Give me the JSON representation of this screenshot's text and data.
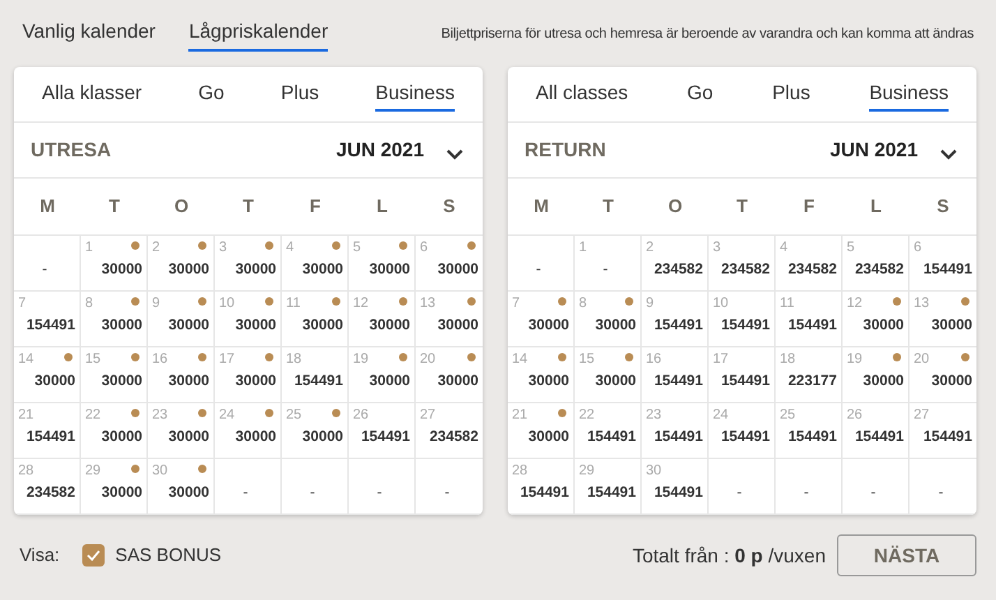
{
  "calendar_tabs": [
    {
      "label": "Vanlig kalender",
      "selected": false
    },
    {
      "label": "Lågpriskalender",
      "selected": true
    }
  ],
  "notice": "Biljettpriserna för utresa och hemresa är beroende av varandra och kan komma att ändras",
  "calendars": [
    {
      "class_tabs": [
        {
          "label": "Alla klasser",
          "selected": false
        },
        {
          "label": "Go",
          "selected": false
        },
        {
          "label": "Plus",
          "selected": false
        },
        {
          "label": "Business",
          "selected": true
        }
      ],
      "title": "UTRESA",
      "month": "JUN 2021",
      "weekdays": [
        "M",
        "T",
        "O",
        "T",
        "F",
        "L",
        "S"
      ],
      "cells": [
        {
          "price": "-",
          "marked": false
        },
        {
          "day": "1",
          "price": "30000",
          "marked": true
        },
        {
          "day": "2",
          "price": "30000",
          "marked": true
        },
        {
          "day": "3",
          "price": "30000",
          "marked": true
        },
        {
          "day": "4",
          "price": "30000",
          "marked": true
        },
        {
          "day": "5",
          "price": "30000",
          "marked": true
        },
        {
          "day": "6",
          "price": "30000",
          "marked": true
        },
        {
          "day": "7",
          "price": "154491",
          "marked": false
        },
        {
          "day": "8",
          "price": "30000",
          "marked": true
        },
        {
          "day": "9",
          "price": "30000",
          "marked": true
        },
        {
          "day": "10",
          "price": "30000",
          "marked": true
        },
        {
          "day": "11",
          "price": "30000",
          "marked": true
        },
        {
          "day": "12",
          "price": "30000",
          "marked": true
        },
        {
          "day": "13",
          "price": "30000",
          "marked": true
        },
        {
          "day": "14",
          "price": "30000",
          "marked": true
        },
        {
          "day": "15",
          "price": "30000",
          "marked": true
        },
        {
          "day": "16",
          "price": "30000",
          "marked": true
        },
        {
          "day": "17",
          "price": "30000",
          "marked": true
        },
        {
          "day": "18",
          "price": "154491",
          "marked": false
        },
        {
          "day": "19",
          "price": "30000",
          "marked": true
        },
        {
          "day": "20",
          "price": "30000",
          "marked": true
        },
        {
          "day": "21",
          "price": "154491",
          "marked": false
        },
        {
          "day": "22",
          "price": "30000",
          "marked": true
        },
        {
          "day": "23",
          "price": "30000",
          "marked": true
        },
        {
          "day": "24",
          "price": "30000",
          "marked": true
        },
        {
          "day": "25",
          "price": "30000",
          "marked": true
        },
        {
          "day": "26",
          "price": "154491",
          "marked": false
        },
        {
          "day": "27",
          "price": "234582",
          "marked": false
        },
        {
          "day": "28",
          "price": "234582",
          "marked": false
        },
        {
          "day": "29",
          "price": "30000",
          "marked": true
        },
        {
          "day": "30",
          "price": "30000",
          "marked": true
        },
        {
          "price": "-",
          "marked": false
        },
        {
          "price": "-",
          "marked": false
        },
        {
          "price": "-",
          "marked": false
        },
        {
          "price": "-",
          "marked": false
        }
      ]
    },
    {
      "class_tabs": [
        {
          "label": "All classes",
          "selected": false
        },
        {
          "label": "Go",
          "selected": false
        },
        {
          "label": "Plus",
          "selected": false
        },
        {
          "label": "Business",
          "selected": true
        }
      ],
      "title": "RETURN",
      "month": "JUN 2021",
      "weekdays": [
        "M",
        "T",
        "O",
        "T",
        "F",
        "L",
        "S"
      ],
      "cells": [
        {
          "price": "-",
          "marked": false
        },
        {
          "day": "1",
          "price": "-",
          "marked": false
        },
        {
          "day": "2",
          "price": "234582",
          "marked": false
        },
        {
          "day": "3",
          "price": "234582",
          "marked": false
        },
        {
          "day": "4",
          "price": "234582",
          "marked": false
        },
        {
          "day": "5",
          "price": "234582",
          "marked": false
        },
        {
          "day": "6",
          "price": "154491",
          "marked": false
        },
        {
          "day": "7",
          "price": "30000",
          "marked": true
        },
        {
          "day": "8",
          "price": "30000",
          "marked": true
        },
        {
          "day": "9",
          "price": "154491",
          "marked": false
        },
        {
          "day": "10",
          "price": "154491",
          "marked": false
        },
        {
          "day": "11",
          "price": "154491",
          "marked": false
        },
        {
          "day": "12",
          "price": "30000",
          "marked": true
        },
        {
          "day": "13",
          "price": "30000",
          "marked": true
        },
        {
          "day": "14",
          "price": "30000",
          "marked": true
        },
        {
          "day": "15",
          "price": "30000",
          "marked": true
        },
        {
          "day": "16",
          "price": "154491",
          "marked": false
        },
        {
          "day": "17",
          "price": "154491",
          "marked": false
        },
        {
          "day": "18",
          "price": "223177",
          "marked": false
        },
        {
          "day": "19",
          "price": "30000",
          "marked": true
        },
        {
          "day": "20",
          "price": "30000",
          "marked": true
        },
        {
          "day": "21",
          "price": "30000",
          "marked": true
        },
        {
          "day": "22",
          "price": "154491",
          "marked": false
        },
        {
          "day": "23",
          "price": "154491",
          "marked": false
        },
        {
          "day": "24",
          "price": "154491",
          "marked": false
        },
        {
          "day": "25",
          "price": "154491",
          "marked": false
        },
        {
          "day": "26",
          "price": "154491",
          "marked": false
        },
        {
          "day": "27",
          "price": "154491",
          "marked": false
        },
        {
          "day": "28",
          "price": "154491",
          "marked": false
        },
        {
          "day": "29",
          "price": "154491",
          "marked": false
        },
        {
          "day": "30",
          "price": "154491",
          "marked": false
        },
        {
          "price": "-",
          "marked": false
        },
        {
          "price": "-",
          "marked": false
        },
        {
          "price": "-",
          "marked": false
        },
        {
          "price": "-",
          "marked": false
        }
      ]
    }
  ],
  "footer": {
    "show_label": "Visa:",
    "bonus": {
      "label": "SAS BONUS",
      "checked": true
    },
    "total": "Totalt från : **0 p** /vuxen",
    "next_button": "NÄSTA"
  }
}
